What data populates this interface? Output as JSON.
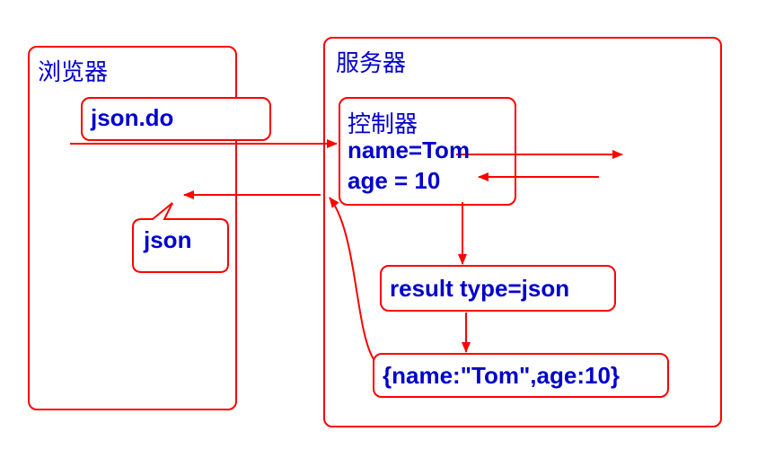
{
  "browser": {
    "title": "浏览器",
    "request": "json.do",
    "response": "json"
  },
  "server": {
    "title": "服务器",
    "controller": {
      "title": "控制器",
      "line1": "name=Tom",
      "line2": "age = 10"
    },
    "result": "result type=json",
    "output": "{name:\"Tom\",age:10}"
  },
  "colors": {
    "stroke": "#ff0000",
    "text": "#0000cc"
  }
}
